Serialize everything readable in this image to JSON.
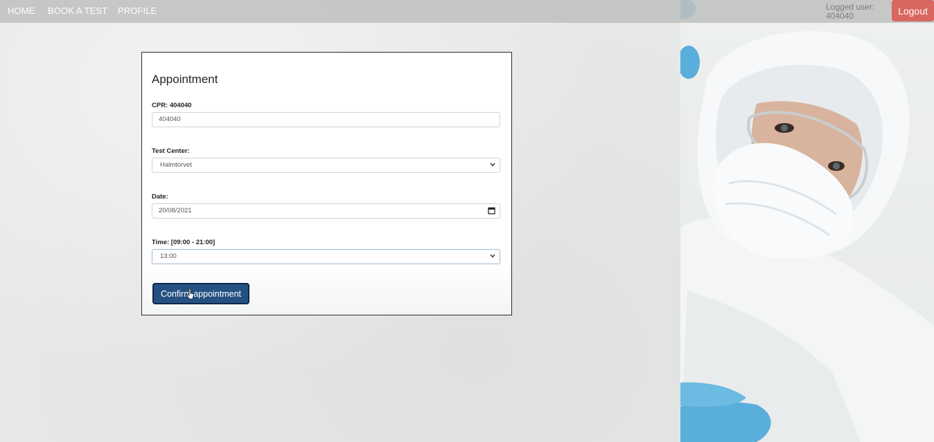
{
  "nav": {
    "items": [
      {
        "label": "HOME"
      },
      {
        "label": "BOOK A TEST"
      },
      {
        "label": "PROFILE"
      }
    ],
    "logged_user_label": "Logged user:",
    "logged_user_id": "404040",
    "logout_label": "Logout"
  },
  "form": {
    "title": "Appointment",
    "cpr_label": "CPR: 404040",
    "cpr_value": "404040",
    "test_center_label": "Test Center:",
    "test_center_value": "Halmtorvet",
    "date_label": "Date:",
    "date_value": "20/08/2021",
    "time_label": "Time: [09:00 - 21:00]",
    "time_value": "13:00",
    "confirm_label": "Confirm appointment"
  },
  "icons": {
    "select_arrow": "chevron-down-icon",
    "calendar": "calendar-icon"
  },
  "colors": {
    "logout_bg": "#d9665f",
    "confirm_bg": "#245182",
    "glove": "#5aaedb"
  }
}
